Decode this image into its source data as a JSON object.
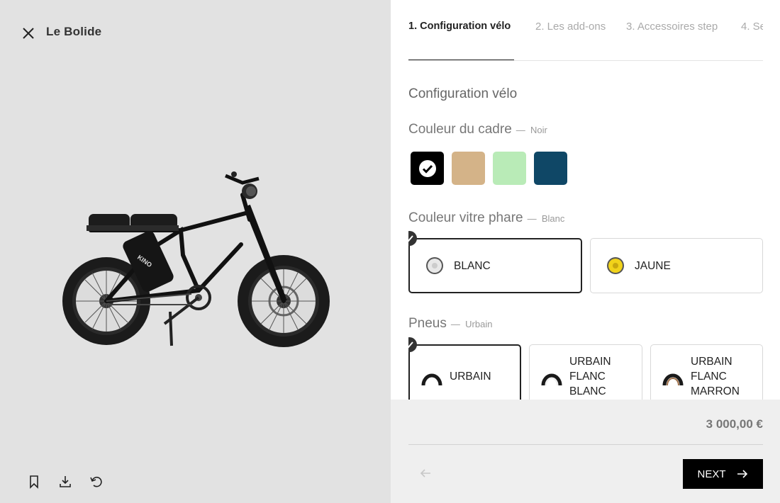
{
  "preview": {
    "product_name": "Le Bolide",
    "bike_brand_text": "KINO"
  },
  "tabs": [
    {
      "label": "1. Configuration vélo",
      "active": true
    },
    {
      "label": "2. Les add-ons",
      "active": false
    },
    {
      "label": "3. Accessoires step",
      "active": false
    },
    {
      "label": "4. Se",
      "active": false
    }
  ],
  "config": {
    "section_title": "Configuration vélo",
    "frame_color": {
      "label": "Couleur du cadre",
      "separator": "—",
      "selected": "Noir",
      "swatches": [
        {
          "name": "Noir",
          "color": "#000000",
          "selected": true
        },
        {
          "name": "Beige",
          "color": "#d4b388",
          "selected": false
        },
        {
          "name": "Vert",
          "color": "#b9ebb7",
          "selected": false
        },
        {
          "name": "Bleu",
          "color": "#0f4766",
          "selected": false
        }
      ]
    },
    "headlight": {
      "label": "Couleur vitre phare",
      "separator": "—",
      "selected": "Blanc",
      "options": [
        {
          "label": "BLANC",
          "selected": true,
          "lens_color": "#e8e8e8"
        },
        {
          "label": "JAUNE",
          "selected": false,
          "lens_color": "#f1d31a"
        }
      ]
    },
    "tires": {
      "label": "Pneus",
      "separator": "—",
      "selected": "Urbain",
      "options": [
        {
          "label": "URBAIN",
          "selected": true,
          "sidewall": "#1a1a1a"
        },
        {
          "label": "URBAIN FLANC BLANC",
          "selected": false,
          "sidewall": "#eeeeee"
        },
        {
          "label": "URBAIN FLANC MARRON",
          "selected": false,
          "sidewall": "#a0714a"
        }
      ]
    }
  },
  "footer": {
    "price": "3 000,00 €",
    "next_label": "NEXT"
  },
  "icons": {
    "close": "close-icon",
    "bookmark": "bookmark-icon",
    "download": "download-icon",
    "reset": "reset-icon",
    "prev": "arrow-left-icon",
    "next": "arrow-right-icon"
  }
}
